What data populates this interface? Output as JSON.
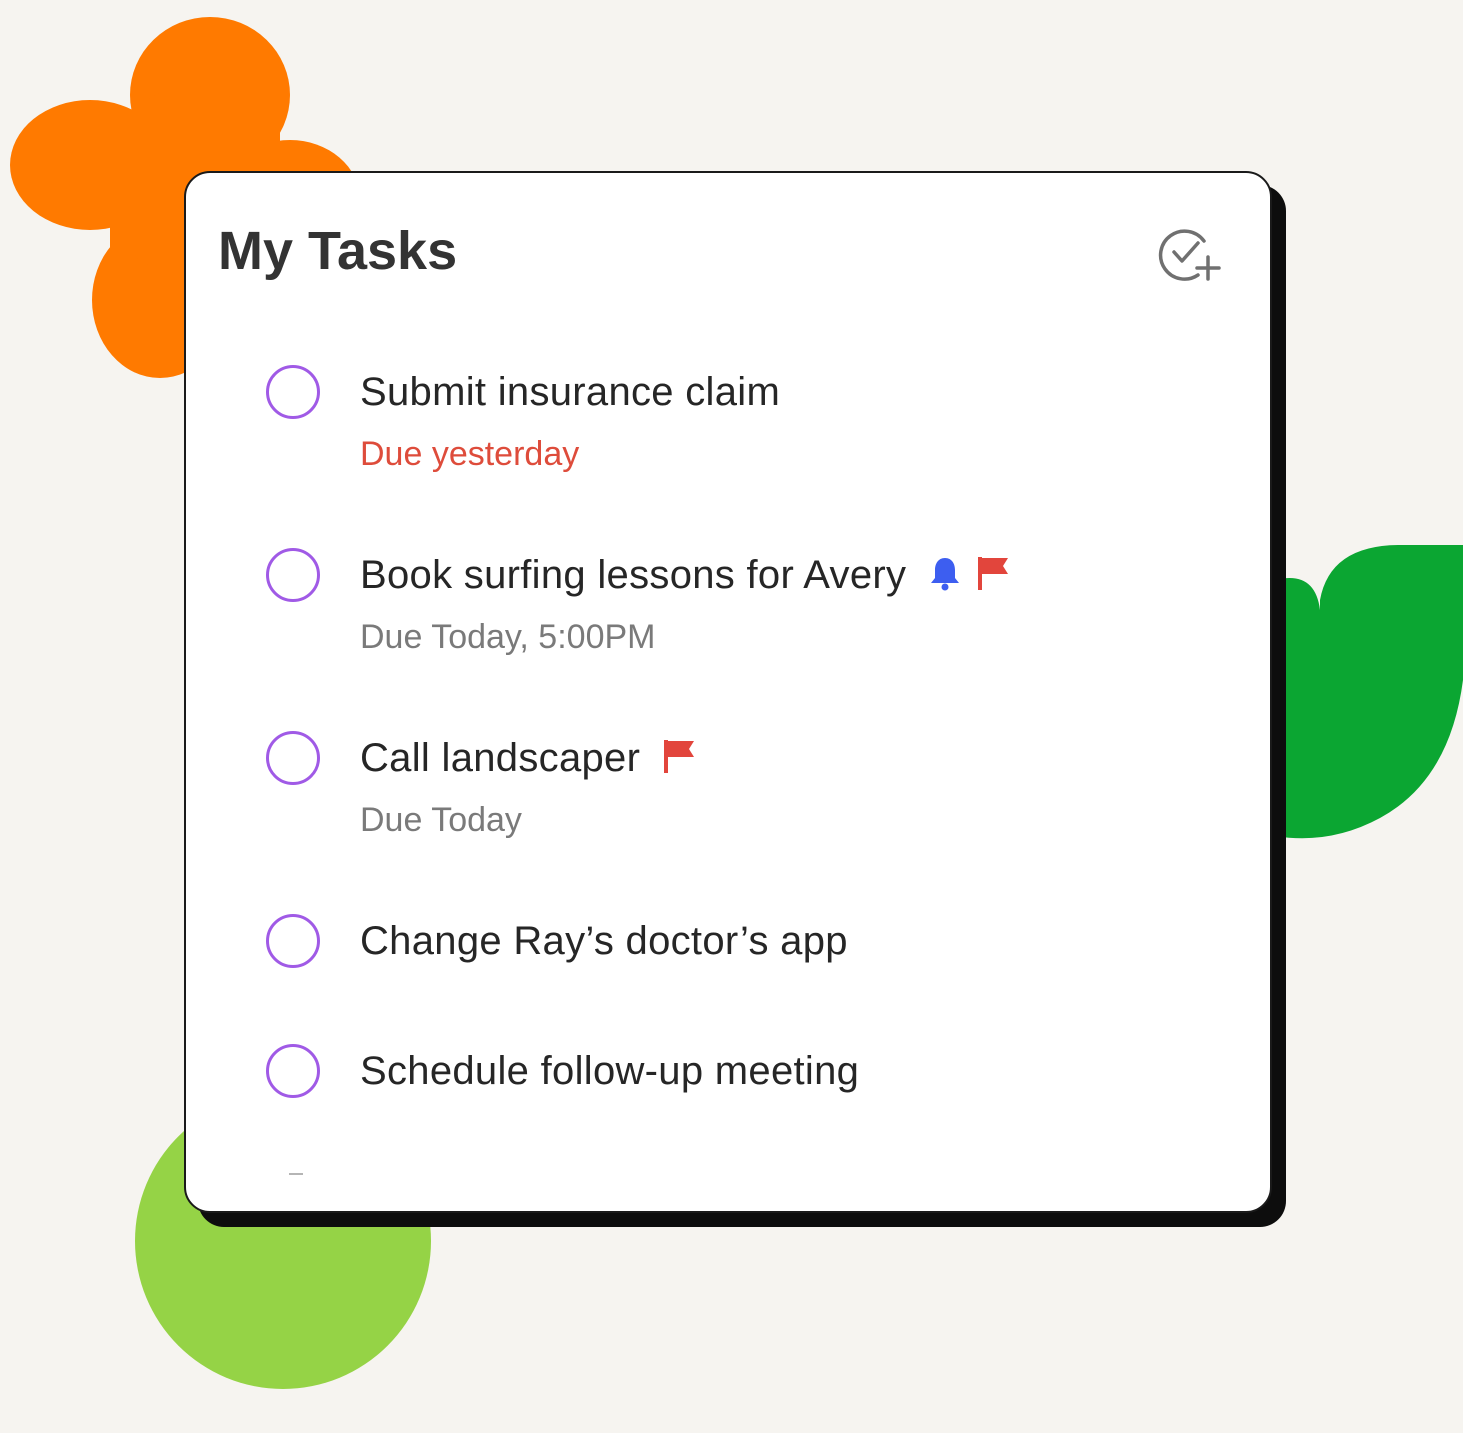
{
  "header": {
    "title": "My Tasks",
    "add_icon": "check-circle-plus-icon"
  },
  "colors": {
    "background": "#f6f4f0",
    "checkbox": "#a05ae6",
    "overdue": "#de4c3b",
    "flag": "#e2453c",
    "bell": "#3d5ef0",
    "deco_orange": "#ff7a00",
    "deco_green": "#0ba632",
    "deco_lime": "#95d346"
  },
  "tasks": [
    {
      "title": "Submit insurance claim",
      "due": "Due yesterday",
      "overdue": true,
      "icons": []
    },
    {
      "title": "Book surfing lessons for Avery",
      "due": "Due Today, 5:00PM",
      "overdue": false,
      "icons": [
        "bell-icon",
        "flag-icon"
      ]
    },
    {
      "title": "Call landscaper",
      "due": "Due Today",
      "overdue": false,
      "icons": [
        "flag-icon"
      ]
    },
    {
      "title": "Change Ray’s doctor’s app",
      "due": "",
      "overdue": false,
      "icons": []
    },
    {
      "title": "Schedule follow-up meeting",
      "due": "",
      "overdue": false,
      "icons": []
    }
  ]
}
